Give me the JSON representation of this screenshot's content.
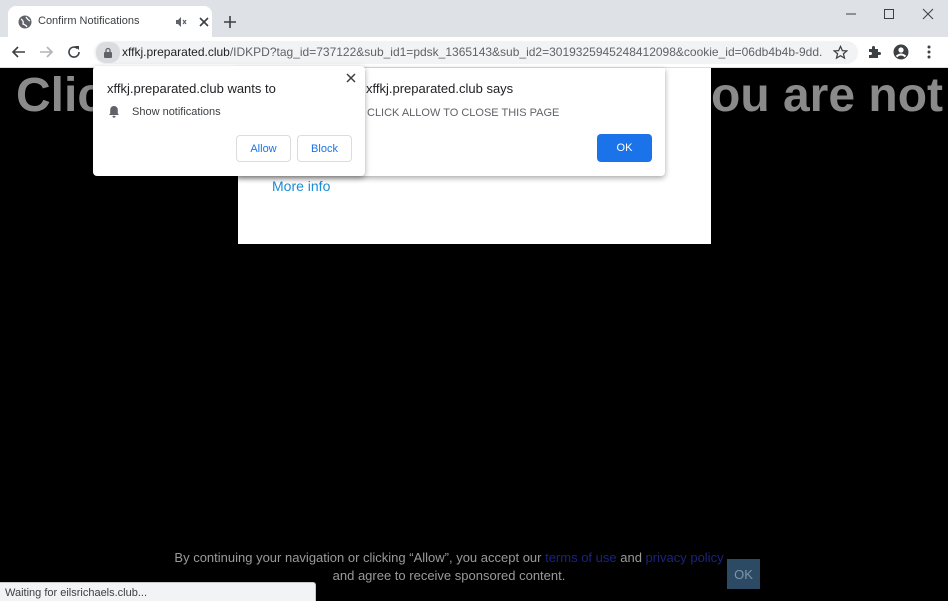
{
  "browser": {
    "tab_title": "Confirm Notifications",
    "url_host": "xffkj.preparated.club",
    "url_path": "/IDKPD?tag_id=737122&sub_id1=pdsk_1365143&sub_id2=3019325945248412098&cookie_id=06db4b4b-9dd..."
  },
  "page": {
    "headline_left": "Clic",
    "headline_right": "ou are not",
    "more_info": "More info",
    "consent": {
      "part1": "By continuing your navigation or clicking “Allow”, you accept our ",
      "terms": "terms of use",
      "and": " and ",
      "privacy": "privacy policy",
      "line2": "and agree to receive sponsored content.",
      "ok": "OK"
    }
  },
  "alert": {
    "title": "xffkj.preparated.club says",
    "message": "CLICK ALLOW TO CLOSE THIS PAGE",
    "ok": "OK"
  },
  "notification_prompt": {
    "title": "xffkj.preparated.club wants to",
    "permission": "Show notifications",
    "allow": "Allow",
    "block": "Block"
  },
  "status": "Waiting for eilsrichaels.club...",
  "colors": {
    "accent": "#1a73e8",
    "page_bg": "#000000",
    "headline": "#8a8a8a"
  }
}
